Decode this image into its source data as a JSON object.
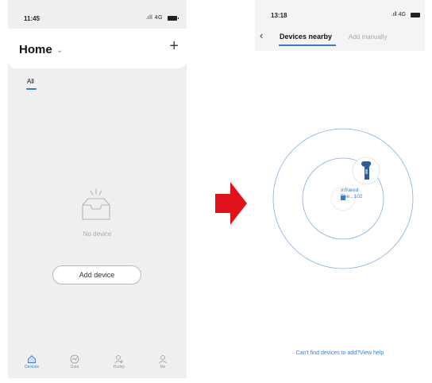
{
  "left": {
    "status": {
      "time": "11:45",
      "signal": ".ıll 4G"
    },
    "header": {
      "title": "Home",
      "chevron": "⌄",
      "add_icon": "+"
    },
    "tabs": [
      {
        "label": "All",
        "active": true
      }
    ],
    "empty_state": {
      "text": "No device",
      "icon": "empty-tray-icon"
    },
    "add_button": {
      "label": "Add device"
    },
    "tabbar": [
      {
        "label": "Devices",
        "icon": "home-icon",
        "active": true
      },
      {
        "label": "Data",
        "icon": "chart-icon"
      },
      {
        "label": "Buddy",
        "icon": "buddy-icon"
      },
      {
        "label": "Me",
        "icon": "person-icon"
      }
    ]
  },
  "right": {
    "status": {
      "time": "13:18",
      "signal": ".ıll 4G"
    },
    "nav": {
      "back_icon": "‹",
      "tab_active": "Devices nearby",
      "tab_other": "Add manually"
    },
    "radar": {
      "device_line1": "Infrared",
      "device_line2": "The...102",
      "device_icon": "thermometer-icon"
    },
    "help": {
      "text": "Can't find devices to add?View help"
    }
  },
  "colors": {
    "accent": "#3a7ad9",
    "arrow": "#e2121b",
    "bg_gray": "#efefef"
  }
}
